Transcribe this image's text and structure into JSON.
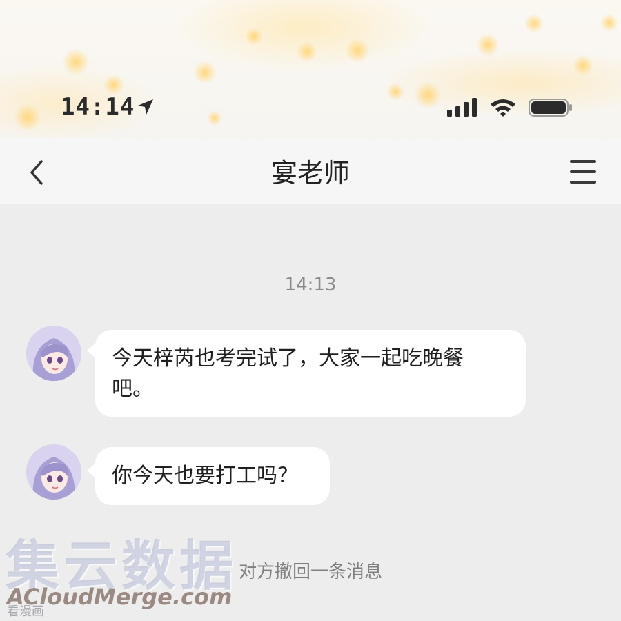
{
  "status_bar": {
    "time": "14:14",
    "location_icon": "location-arrow-icon",
    "signal_icon": "cellular-signal-icon",
    "wifi_icon": "wifi-icon",
    "battery_icon": "battery-icon"
  },
  "nav": {
    "title": "宴老师",
    "back_icon": "chevron-left-icon",
    "menu_icon": "menu-icon"
  },
  "chat": {
    "timestamp": "14:13",
    "messages": [
      {
        "sender": "宴老师",
        "text_line1": "今天梓芮也考完试了，大家一起吃晚餐",
        "text_line2": "吧。"
      },
      {
        "sender": "宴老师",
        "text_line1": "你今天也要打工吗？"
      }
    ],
    "recall_notice": "对方撤回一条消息"
  },
  "watermark": {
    "brand_cn": "集云数据",
    "brand_en": "ACloudMerge.com",
    "site": "看漫画"
  },
  "colors": {
    "chat_background": "#ededed",
    "bubble_background": "#ffffff",
    "text_primary": "#1f1f1f",
    "text_muted": "#8a8a8a"
  }
}
